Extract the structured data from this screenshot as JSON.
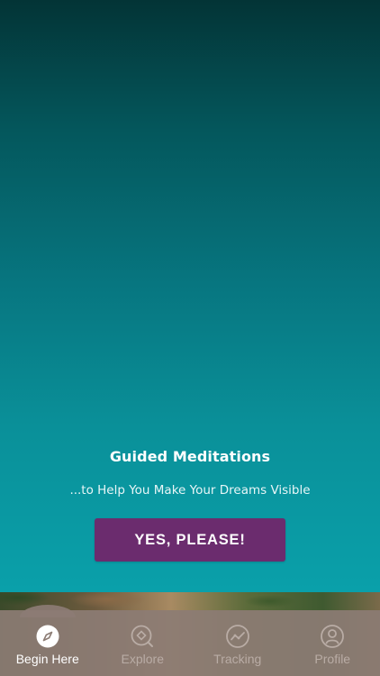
{
  "hero": {
    "title": "Guided Meditations",
    "subtitle": "...to Help You Make Your Dreams Visible",
    "cta_label": "YES, PLEASE!"
  },
  "tabbar": {
    "tabs": [
      {
        "label": "Begin Here",
        "icon": "compass-icon",
        "active": true
      },
      {
        "label": "Explore",
        "icon": "explore-search-icon",
        "active": false
      },
      {
        "label": "Tracking",
        "icon": "tracking-chart-icon",
        "active": false
      },
      {
        "label": "Profile",
        "icon": "profile-person-icon",
        "active": false
      }
    ]
  },
  "colors": {
    "cta_background": "#6b2c6e",
    "gradient_top": "#033436",
    "gradient_bottom": "#0aa0aa",
    "tabbar_background": "#8c7c74",
    "tab_active_text": "#ffffff",
    "tab_inactive_text": "#b9aca5"
  }
}
